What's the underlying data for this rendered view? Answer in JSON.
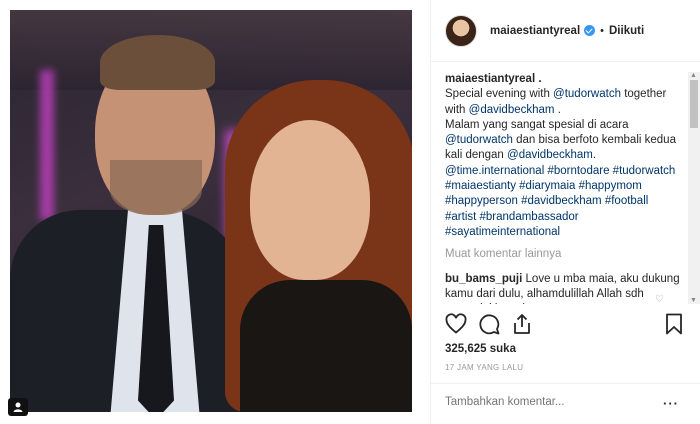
{
  "post": {
    "username": "maiaestiantyreal",
    "follow_label": "Diikuti",
    "likes": "325,625 suka",
    "time": "17 JAM YANG LALU",
    "add_comment_placeholder": "Tambahkan komentar...",
    "options_label": "···",
    "caption_user": "maiaestiantyreal .",
    "caption_text_1": "Special evening with",
    "caption_link_1": "@tudorwatch",
    "caption_text_2": "together with",
    "caption_link_2": "@davidbeckham",
    "caption_text_3": ".",
    "caption_text_4": "Malam yang sangat spesial di acara",
    "caption_link_3": "@tudorwatch",
    "caption_text_5": "dan bisa berfoto kembali kedua kali dengan",
    "caption_link_4": "@davidbeckham",
    "caption_text_6": ".",
    "caption_link_5": "@time.international",
    "hashtags": "#borntodare #tudorwatch #maiaestianty #diarymaia #happymom #happyperson #davidbeckham #football #artist #brandambassador #sayatimeinternational",
    "more_comments": "Muat komentar lainnya",
    "comment_user": "bu_bams_puji",
    "comment_text": "Love u mba maia, aku dukung kamu dari dulu, alhamdulillah Allah sdh menunjukkan siapa yg"
  },
  "icons": {
    "verified": "verified-badge-icon",
    "like": "heart-icon",
    "comment": "comment-icon",
    "share": "share-icon",
    "save": "bookmark-icon",
    "tag": "user-tag-icon"
  },
  "colors": {
    "link": "#003569",
    "verified": "#3897f0",
    "muted": "#999999"
  }
}
